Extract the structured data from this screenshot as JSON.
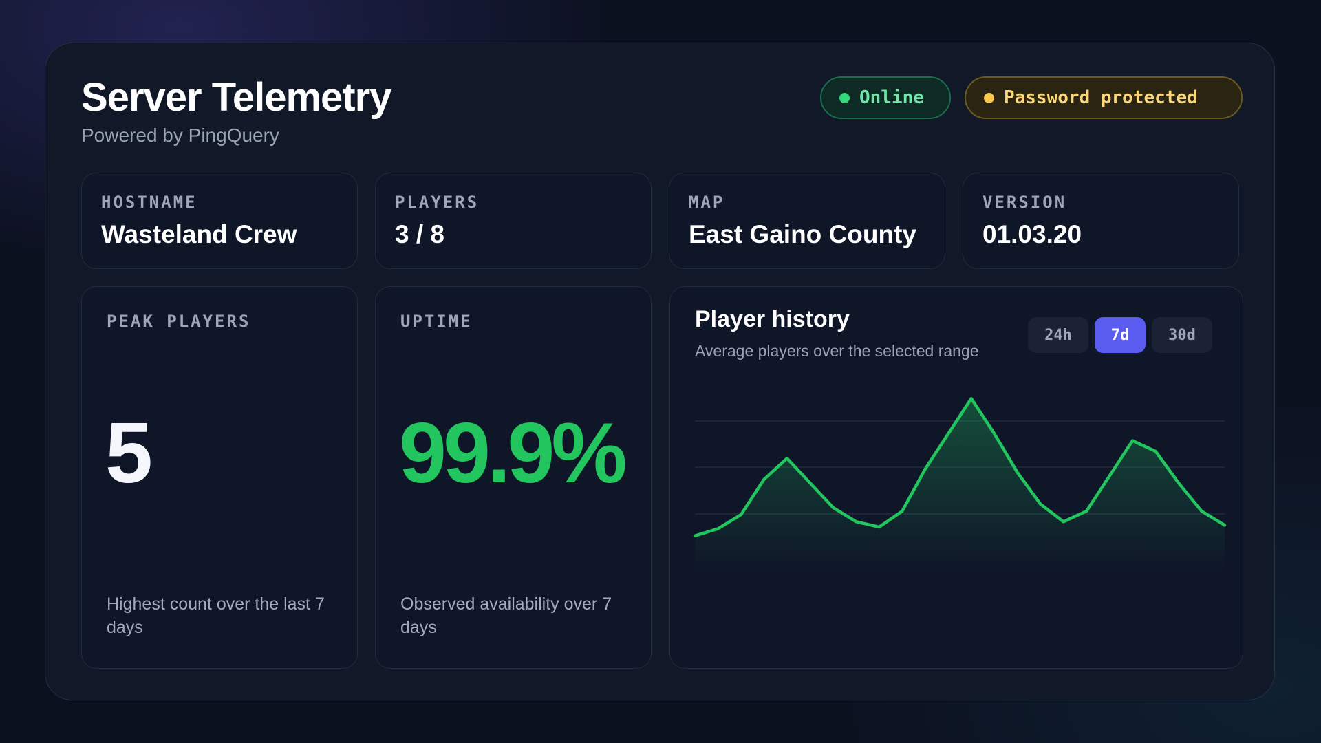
{
  "header": {
    "title": "Server Telemetry",
    "subtitle": "Powered by PingQuery",
    "badges": [
      {
        "label": "Online",
        "color": "#22c55e"
      },
      {
        "label": "Password protected",
        "color": "#fbbf24"
      }
    ]
  },
  "info": [
    {
      "label": "HOSTNAME",
      "value": "Wasteland Crew"
    },
    {
      "label": "PLAYERS",
      "value": "3 / 8"
    },
    {
      "label": "MAP",
      "value": "East Gaino County"
    },
    {
      "label": "VERSION",
      "value": "01.03.20"
    }
  ],
  "stats": {
    "peak": {
      "label": "PEAK PLAYERS",
      "value": "5",
      "description": "Highest count over the last 7 days"
    },
    "uptime": {
      "label": "UPTIME",
      "value": "99.9%",
      "description": "Observed availability over 7 days"
    }
  },
  "history": {
    "title": "Player history",
    "subtitle": "Average players over the selected range",
    "ranges": [
      "24h",
      "7d",
      "30d"
    ],
    "active_range": "7d"
  },
  "chart_data": {
    "type": "area",
    "title": "Player history",
    "grid": true,
    "color": "#22c55e",
    "values": [
      0.2,
      0.4,
      0.8,
      1.8,
      2.4,
      1.7,
      1.0,
      0.6,
      0.45,
      0.9,
      2.1,
      3.1,
      4.1,
      3.1,
      2.0,
      1.1,
      0.6,
      0.9,
      1.9,
      2.9,
      2.6,
      1.7,
      0.9,
      0.5
    ],
    "ylim": [
      0,
      4.3
    ]
  }
}
